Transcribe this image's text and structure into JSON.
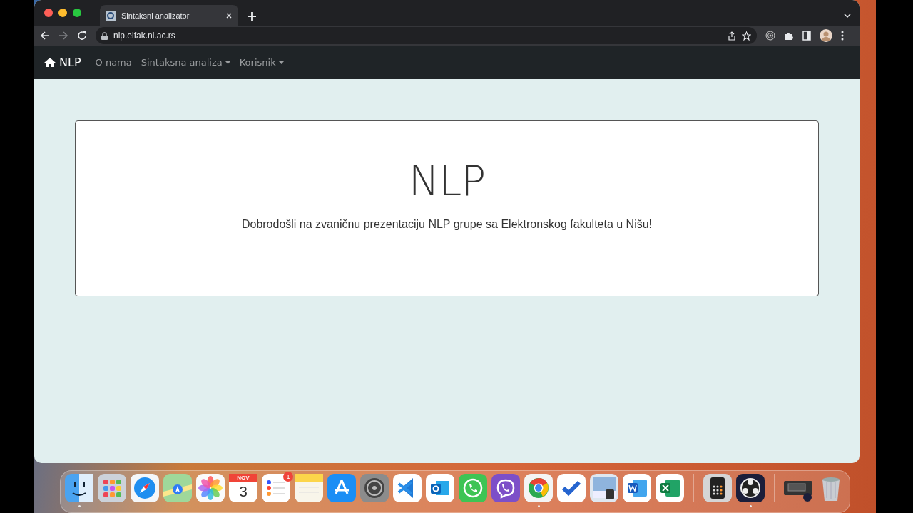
{
  "browser": {
    "tab": {
      "title": "Sintaksni analizator",
      "selected": true
    },
    "address": "nlp.elfak.ni.ac.rs"
  },
  "navbar": {
    "brand": "NLP",
    "items": [
      {
        "label": "O nama",
        "dropdown": false
      },
      {
        "label": "Sintaksna analiza",
        "dropdown": true
      },
      {
        "label": "Korisnik",
        "dropdown": true
      }
    ]
  },
  "hero": {
    "title": "NLP",
    "subtitle": "Dobrodošli na zvaničnu prezentaciju NLP grupe sa Elektronskog fakulteta u Nišu!"
  },
  "dock": [
    {
      "kind": "finder",
      "running": true
    },
    {
      "kind": "launchpad",
      "running": false
    },
    {
      "kind": "safari",
      "running": false
    },
    {
      "kind": "maps",
      "running": false
    },
    {
      "kind": "photos",
      "running": false
    },
    {
      "kind": "calendar",
      "running": false,
      "month": "NOV",
      "day": "3"
    },
    {
      "kind": "reminders",
      "running": false,
      "badge": "1"
    },
    {
      "kind": "notes",
      "running": false
    },
    {
      "kind": "appstore",
      "running": false
    },
    {
      "kind": "settings",
      "running": false
    },
    {
      "kind": "vscode",
      "running": false
    },
    {
      "kind": "outlook",
      "running": false
    },
    {
      "kind": "whatsapp",
      "running": false
    },
    {
      "kind": "viber",
      "running": false
    },
    {
      "kind": "chrome",
      "running": true
    },
    {
      "kind": "todo",
      "running": false
    },
    {
      "kind": "preview",
      "running": false
    },
    {
      "kind": "word",
      "running": false
    },
    {
      "kind": "excel",
      "running": false
    },
    {
      "kind": "separator"
    },
    {
      "kind": "calculator",
      "running": false
    },
    {
      "kind": "obs",
      "running": true
    },
    {
      "kind": "separator"
    },
    {
      "kind": "screenshot",
      "running": false
    },
    {
      "kind": "trash",
      "running": false
    }
  ]
}
